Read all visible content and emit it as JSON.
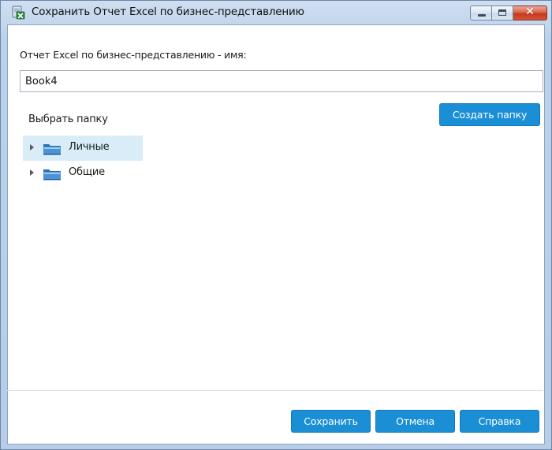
{
  "window": {
    "title": "Сохранить Отчет Excel по бизнес-представлению",
    "icon": "excel-report-icon",
    "close_glyph": "✕"
  },
  "form": {
    "name_label": "Отчет Excel по бизнес-представлению - имя:",
    "name_value": "Book4",
    "folder_label": "Выбрать папку",
    "create_folder_label": "Создать папку"
  },
  "tree": {
    "items": [
      {
        "label": "Личные",
        "icon": "folder-icon",
        "selected": true
      },
      {
        "label": "Общие",
        "icon": "folder-icon",
        "selected": false
      }
    ]
  },
  "footer": {
    "save_label": "Сохранить",
    "cancel_label": "Отмена",
    "help_label": "Справка"
  },
  "colors": {
    "accent_button": "#1a8fd6",
    "selection": "#d9edf9",
    "titlebar": "#bcd1ea"
  }
}
